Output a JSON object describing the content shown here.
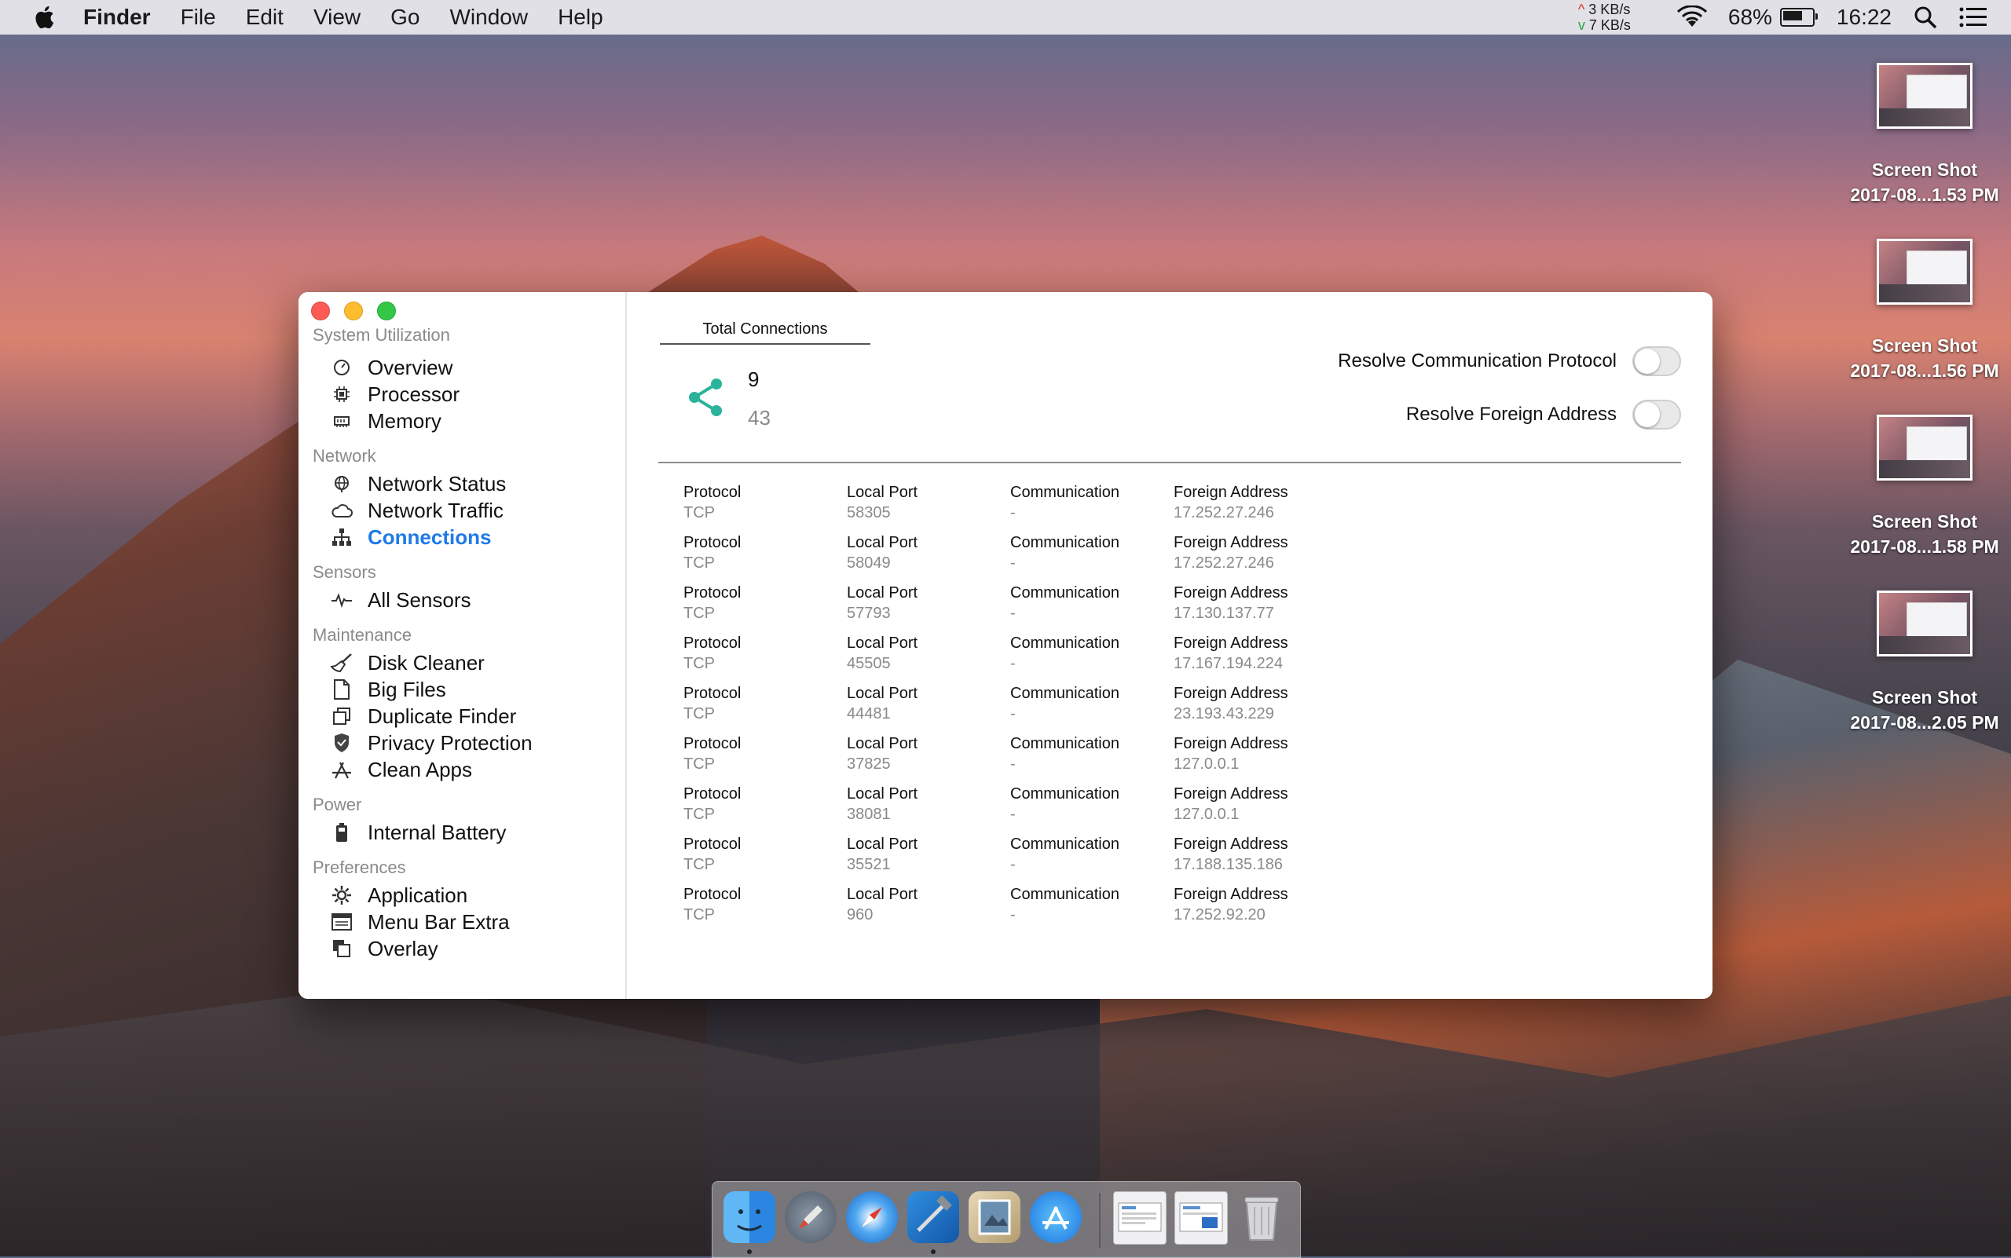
{
  "menubar": {
    "apple": "apple-logo",
    "items": [
      "Finder",
      "File",
      "Edit",
      "View",
      "Go",
      "Window",
      "Help"
    ],
    "net_up": "3 KB/s",
    "net_down": "7 KB/s",
    "battery_pct": "68%",
    "battery_level": 0.68,
    "clock": "16:22"
  },
  "desktop": {
    "icons": [
      {
        "line1": "Screen Shot",
        "line2": "2017-08...1.53 PM"
      },
      {
        "line1": "Screen Shot",
        "line2": "2017-08...1.56 PM"
      },
      {
        "line1": "Screen Shot",
        "line2": "2017-08...1.58 PM"
      },
      {
        "line1": "Screen Shot",
        "line2": "2017-08...2.05 PM"
      }
    ]
  },
  "sidebar": {
    "sections": {
      "system": "System Utilization",
      "network": "Network",
      "sensors": "Sensors",
      "maintenance": "Maintenance",
      "power": "Power",
      "preferences": "Preferences"
    },
    "items": {
      "overview": "Overview",
      "processor": "Processor",
      "memory": "Memory",
      "network_status": "Network Status",
      "network_traffic": "Network Traffic",
      "connections": "Connections",
      "all_sensors": "All Sensors",
      "disk_cleaner": "Disk Cleaner",
      "big_files": "Big Files",
      "duplicate_finder": "Duplicate Finder",
      "privacy_protection": "Privacy Protection",
      "clean_apps": "Clean Apps",
      "internal_battery": "Internal Battery",
      "application": "Application",
      "menu_bar_extra": "Menu Bar Extra",
      "overlay": "Overlay"
    },
    "accent": "#1f7ae8"
  },
  "main": {
    "tab_title": "Total Connections",
    "count_primary": "9",
    "count_secondary": "43",
    "toggle_protocol_label": "Resolve Communication Protocol",
    "toggle_address_label": "Resolve Foreign Address",
    "toggle_protocol_on": false,
    "toggle_address_on": false,
    "headers": {
      "protocol": "Protocol",
      "local_port": "Local Port",
      "communication": "Communication",
      "foreign_address": "Foreign Address"
    },
    "connections": [
      {
        "protocol": "TCP",
        "local_port": "58305",
        "communication": "-",
        "foreign_address": "17.252.27.246"
      },
      {
        "protocol": "TCP",
        "local_port": "58049",
        "communication": "-",
        "foreign_address": "17.252.27.246"
      },
      {
        "protocol": "TCP",
        "local_port": "57793",
        "communication": "-",
        "foreign_address": "17.130.137.77"
      },
      {
        "protocol": "TCP",
        "local_port": "45505",
        "communication": "-",
        "foreign_address": "17.167.194.224"
      },
      {
        "protocol": "TCP",
        "local_port": "44481",
        "communication": "-",
        "foreign_address": "23.193.43.229"
      },
      {
        "protocol": "TCP",
        "local_port": "37825",
        "communication": "-",
        "foreign_address": "127.0.0.1"
      },
      {
        "protocol": "TCP",
        "local_port": "38081",
        "communication": "-",
        "foreign_address": "127.0.0.1"
      },
      {
        "protocol": "TCP",
        "local_port": "35521",
        "communication": "-",
        "foreign_address": "17.188.135.186"
      },
      {
        "protocol": "TCP",
        "local_port": "960",
        "communication": "-",
        "foreign_address": "17.252.92.20"
      }
    ]
  },
  "dock": {
    "apps": [
      "finder-icon",
      "launchpad-icon",
      "safari-icon",
      "xcode-icon",
      "preview-icon",
      "app-store-icon",
      "screenshot-stack-icon",
      "screenshot-stack-icon",
      "trash-icon"
    ]
  }
}
